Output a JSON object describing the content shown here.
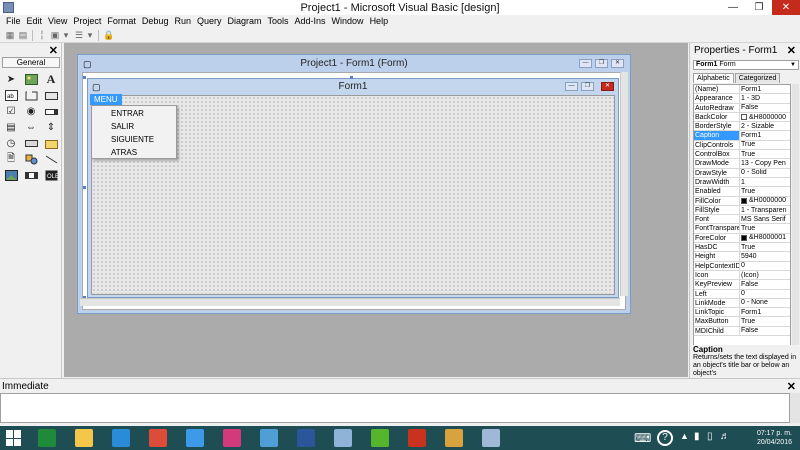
{
  "window": {
    "title": "Project1 - Microsoft Visual Basic [design]"
  },
  "menubar": [
    "File",
    "Edit",
    "View",
    "Project",
    "Format",
    "Debug",
    "Run",
    "Query",
    "Diagram",
    "Tools",
    "Add-Ins",
    "Window",
    "Help"
  ],
  "toolbox": {
    "tab_label": "General"
  },
  "project_window": {
    "title": "Project1 - Form1 (Form)"
  },
  "form": {
    "title": "Form1",
    "menu_label": "MENU",
    "menu_items": [
      "ENTRAR",
      "SALIR",
      "SIGUIENTE",
      "ATRAS"
    ]
  },
  "properties": {
    "title": "Properties - Form1",
    "object_name": "Form1",
    "object_type": "Form",
    "tabs": [
      "Alphabetic",
      "Categorized"
    ],
    "rows": [
      {
        "name": "(Name)",
        "value": "Form1"
      },
      {
        "name": "Appearance",
        "value": "1 - 3D"
      },
      {
        "name": "AutoRedraw",
        "value": "False"
      },
      {
        "name": "BackColor",
        "value": "&H8000000",
        "swatch": "#ffffff"
      },
      {
        "name": "BorderStyle",
        "value": "2 - Sizable"
      },
      {
        "name": "Caption",
        "value": "Form1",
        "selected": true
      },
      {
        "name": "ClipControls",
        "value": "True"
      },
      {
        "name": "ControlBox",
        "value": "True"
      },
      {
        "name": "DrawMode",
        "value": "13 - Copy Pen"
      },
      {
        "name": "DrawStyle",
        "value": "0 - Solid"
      },
      {
        "name": "DrawWidth",
        "value": "1"
      },
      {
        "name": "Enabled",
        "value": "True"
      },
      {
        "name": "FillColor",
        "value": "&H0000000",
        "swatch": "#000000"
      },
      {
        "name": "FillStyle",
        "value": "1 - Transparen"
      },
      {
        "name": "Font",
        "value": "MS Sans Serif"
      },
      {
        "name": "FontTransparen",
        "value": "True"
      },
      {
        "name": "ForeColor",
        "value": "&H8000001",
        "swatch": "#000000"
      },
      {
        "name": "HasDC",
        "value": "True"
      },
      {
        "name": "Height",
        "value": "5940"
      },
      {
        "name": "HelpContextID",
        "value": "0"
      },
      {
        "name": "Icon",
        "value": "(Icon)"
      },
      {
        "name": "KeyPreview",
        "value": "False"
      },
      {
        "name": "Left",
        "value": "0"
      },
      {
        "name": "LinkMode",
        "value": "0 - None"
      },
      {
        "name": "LinkTopic",
        "value": "Form1"
      },
      {
        "name": "MaxButton",
        "value": "True"
      },
      {
        "name": "MDIChild",
        "value": "False"
      }
    ],
    "description_title": "Caption",
    "description_text": "Returns/sets the text displayed in an object's title bar or below an object's"
  },
  "immediate": {
    "title": "Immediate"
  },
  "taskbar": {
    "time": "07:17 p. m.",
    "date": "20/04/2016",
    "apps": [
      {
        "name": "excel-icon",
        "color": "#1f8a3a"
      },
      {
        "name": "file-explorer-icon",
        "color": "#f4c64a"
      },
      {
        "name": "internet-explorer-icon",
        "color": "#2a8bd8"
      },
      {
        "name": "chrome-icon",
        "color": "#dd4b39"
      },
      {
        "name": "dropbox-icon",
        "color": "#3d9ae8"
      },
      {
        "name": "media-app-icon",
        "color": "#d33a7b"
      },
      {
        "name": "control-panel-icon",
        "color": "#4f9fd6"
      },
      {
        "name": "word-icon",
        "color": "#2b579a"
      },
      {
        "name": "notes-icon",
        "color": "#8fb3d6"
      },
      {
        "name": "green-app-icon",
        "color": "#55b52d"
      },
      {
        "name": "flash-icon",
        "color": "#c8321f"
      },
      {
        "name": "music-app-icon",
        "color": "#d8a23d"
      },
      {
        "name": "visual-basic-icon",
        "color": "#9fb8d8"
      }
    ]
  }
}
